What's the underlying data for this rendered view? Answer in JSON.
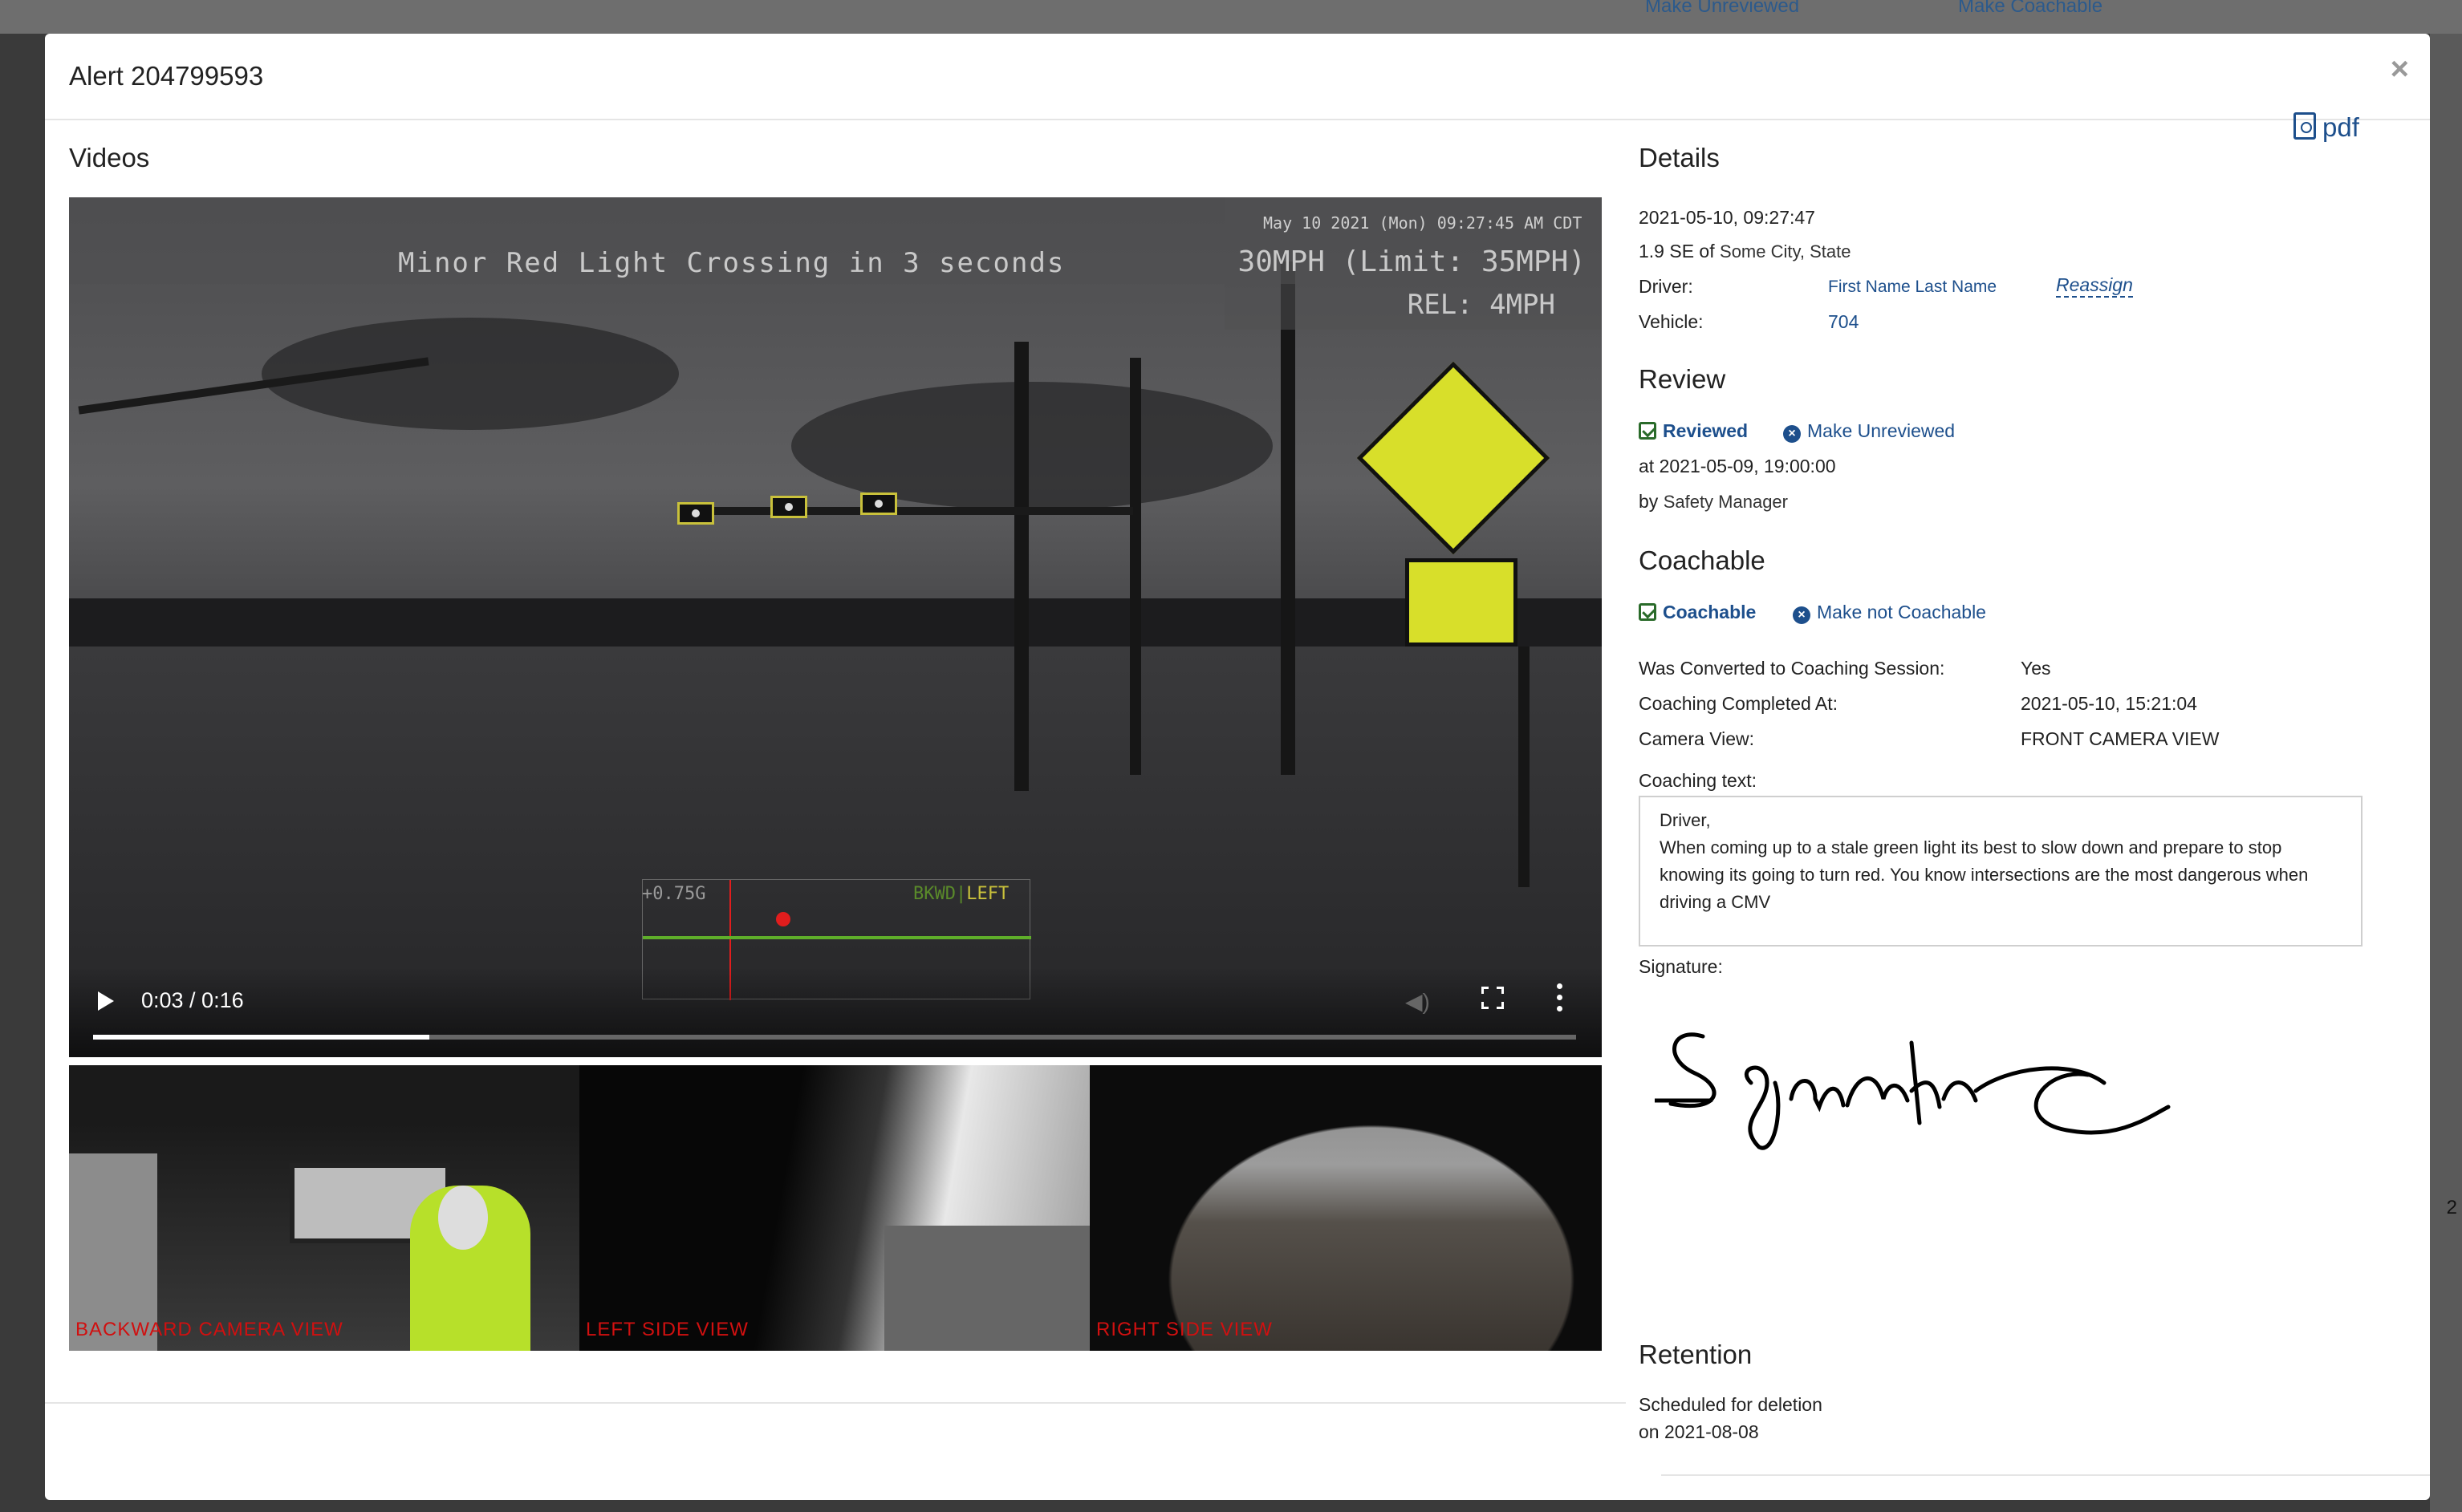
{
  "background": {
    "links": [
      "Make Unreviewed",
      "Make Coachable"
    ],
    "side_text": "2"
  },
  "modal": {
    "title": "Alert 204799593",
    "close_label": "×"
  },
  "videos": {
    "heading": "Videos",
    "main": {
      "alert_text": "Minor Red Light Crossing in 3 seconds",
      "timestamp_text": "May 10 2021 (Mon) 09:27:45 AM CDT",
      "speed_text": "30MPH (Limit: 35MPH)",
      "rel_text": "REL: 4MPH",
      "gforce_text": "+0.75G",
      "direction_text": "BKWD",
      "direction_left": "LEFT",
      "time_display": "0:03 / 0:16",
      "progress_fraction": 0.227
    },
    "thumbnails": [
      {
        "label": "BACKWARD CAMERA VIEW"
      },
      {
        "label": "LEFT SIDE VIEW"
      },
      {
        "label": "RIGHT SIDE VIEW"
      }
    ]
  },
  "details": {
    "heading": "Details",
    "pdf_label": "pdf",
    "datetime": "2021-05-10, 09:27:47",
    "location_prefix": "1.9 SE of",
    "location": "Some City, State",
    "driver_label": "Driver:",
    "driver_name": "First Name Last Name",
    "reassign_label": "Reassign",
    "vehicle_label": "Vehicle:",
    "vehicle_value": "704"
  },
  "review": {
    "heading": "Review",
    "status": "Reviewed",
    "action": "Make Unreviewed",
    "at_text": "at 2021-05-09, 19:00:00",
    "by_prefix": "by",
    "by_value": "Safety Manager"
  },
  "coachable": {
    "heading": "Coachable",
    "status": "Coachable",
    "action": "Make not Coachable",
    "fields": [
      {
        "label": "Was Converted to Coaching Session:",
        "value": "Yes"
      },
      {
        "label": "Coaching Completed At:",
        "value": "2021-05-10, 15:21:04"
      },
      {
        "label": "Camera View:",
        "value": "FRONT CAMERA VIEW"
      }
    ],
    "coaching_text_label": "Coaching text:",
    "coaching_text_greeting": "Driver,",
    "coaching_text_body": "When coming up to a stale green light its best to slow down and prepare to stop knowing its going to turn red. You know intersections are the most dangerous when driving a CMV",
    "signature_label": "Signature:",
    "signature_text": "Signature"
  },
  "retention": {
    "heading": "Retention",
    "line1": "Scheduled for deletion",
    "line2": "on 2021-08-08"
  },
  "colors": {
    "link": "#1d4f8c",
    "check": "#2a6b2a",
    "camera_label": "#d01010",
    "signal_box": "#c9c13b"
  }
}
